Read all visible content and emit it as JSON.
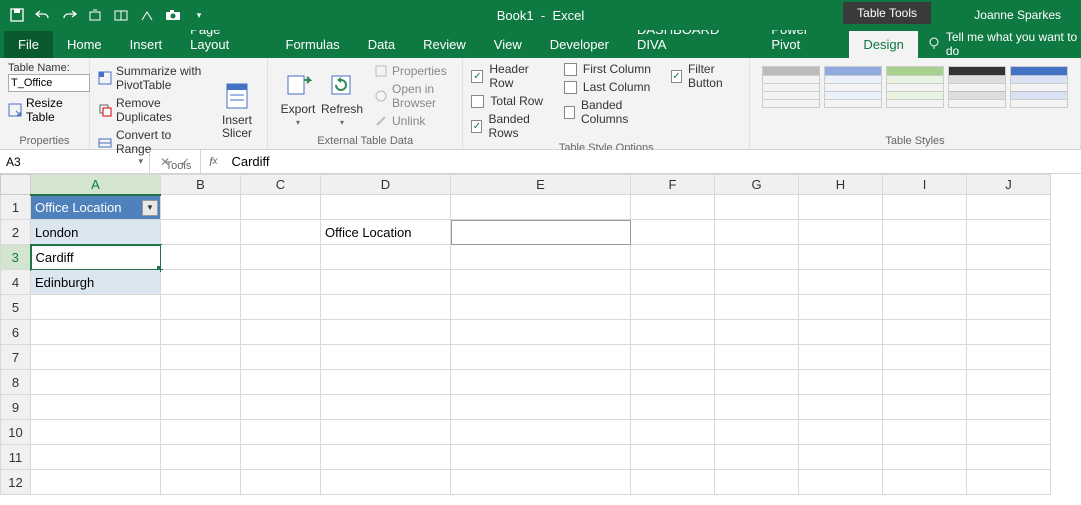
{
  "title": {
    "doc": "Book1",
    "app": "Excel",
    "tools_tab": "Table Tools",
    "user": "Joanne Sparkes"
  },
  "tabs": [
    "File",
    "Home",
    "Insert",
    "Page Layout",
    "Formulas",
    "Data",
    "Review",
    "View",
    "Developer",
    "DASHBOARD DIVA",
    "Power Pivot",
    "Design"
  ],
  "tell_me": "Tell me what you want to do",
  "ribbon": {
    "properties": {
      "label": "Properties",
      "table_name_label": "Table Name:",
      "table_name_value": "T_Office",
      "resize": "Resize Table"
    },
    "tools": {
      "label": "Tools",
      "summarize": "Summarize with PivotTable",
      "remove_dupes": "Remove Duplicates",
      "convert": "Convert to Range",
      "slicer": "Insert\nSlicer"
    },
    "external": {
      "label": "External Table Data",
      "export": "Export",
      "refresh": "Refresh",
      "props": "Properties",
      "browser": "Open in Browser",
      "unlink": "Unlink"
    },
    "styleopts": {
      "label": "Table Style Options",
      "header_row": "Header Row",
      "total_row": "Total Row",
      "banded_rows": "Banded Rows",
      "first_col": "First Column",
      "last_col": "Last Column",
      "banded_cols": "Banded Columns",
      "filter": "Filter Button",
      "checked": {
        "header_row": true,
        "total_row": false,
        "banded_rows": true,
        "first_col": false,
        "last_col": false,
        "banded_cols": false,
        "filter": true
      }
    },
    "styles": {
      "label": "Table Styles"
    }
  },
  "fx": {
    "name_box": "A3",
    "formula": "Cardiff"
  },
  "columns": [
    "A",
    "B",
    "C",
    "D",
    "E",
    "F",
    "G",
    "H",
    "I",
    "J"
  ],
  "rows": 12,
  "cells": {
    "A1": "Office Location",
    "A2": "London",
    "A3": "Cardiff",
    "A4": "Edinburgh",
    "D2": "Office Location"
  },
  "active_cell": "A3",
  "secondary_selection": "E2",
  "table_range": {
    "col": "A",
    "rows": [
      1,
      4
    ]
  },
  "chart_data": null
}
